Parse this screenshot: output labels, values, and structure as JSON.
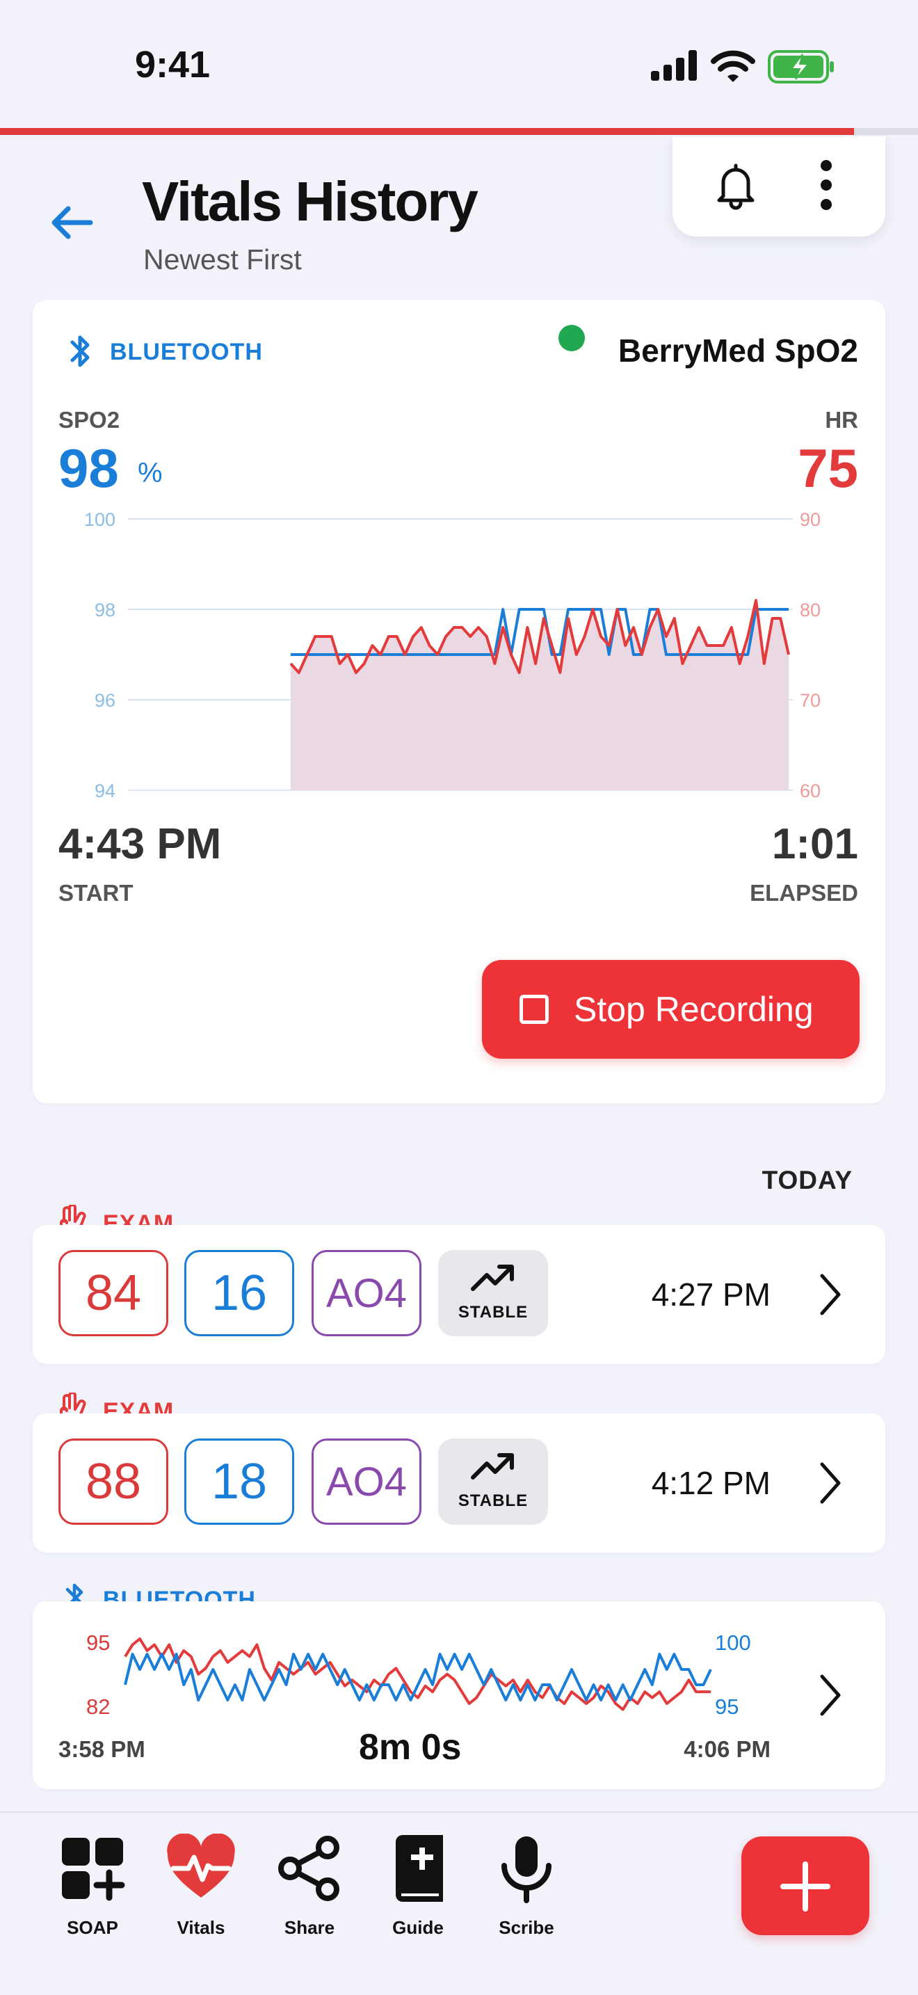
{
  "status_bar": {
    "time": "9:41"
  },
  "progress": {
    "fraction": 0.93
  },
  "header": {
    "title": "Vitals History",
    "subtitle": "Newest First"
  },
  "live": {
    "source": "BLUETOOTH",
    "device": "BerryMed SpO2",
    "spo2_label": "SPO2",
    "spo2_value": "98",
    "spo2_unit": "%",
    "hr_label": "HR",
    "hr_value": "75",
    "start_time": "4:43 PM",
    "start_label": "START",
    "elapsed_time": "1:01",
    "elapsed_label": "ELAPSED",
    "stop_label": "Stop Recording"
  },
  "section": {
    "today": "TODAY"
  },
  "entries": [
    {
      "tag": "EXAM",
      "hr": "84",
      "rr": "16",
      "ao": "AO4",
      "trend": "STABLE",
      "time": "4:27 PM"
    },
    {
      "tag": "EXAM",
      "hr": "88",
      "rr": "18",
      "ao": "AO4",
      "trend": "STABLE",
      "time": "4:12 PM"
    }
  ],
  "bt_entry": {
    "tag": "BLUETOOTH",
    "left_top": "95",
    "left_bottom": "82",
    "right_top": "100",
    "right_bottom": "95",
    "start": "3:58 PM",
    "duration": "8m 0s",
    "end": "4:06 PM"
  },
  "nav": {
    "items": [
      {
        "label": "SOAP",
        "icon": "soap-icon"
      },
      {
        "label": "Vitals",
        "icon": "heart-pulse-icon"
      },
      {
        "label": "Share",
        "icon": "share-icon"
      },
      {
        "label": "Guide",
        "icon": "guide-book-icon"
      },
      {
        "label": "Scribe",
        "icon": "microphone-icon"
      }
    ]
  },
  "colors": {
    "accent_red": "#ee3338",
    "accent_blue": "#1a7ed8",
    "accent_purple": "#8a4aad",
    "online_green": "#1fa84f"
  },
  "chart_data": [
    {
      "type": "line",
      "title": "",
      "x": [
        0,
        1,
        2,
        3,
        4,
        5,
        6,
        7,
        8,
        9,
        10,
        11,
        12,
        13,
        14,
        15,
        16,
        17,
        18,
        19,
        20,
        21,
        22,
        23,
        24,
        25,
        26,
        27,
        28,
        29,
        30,
        31,
        32,
        33,
        34,
        35,
        36,
        37,
        38,
        39,
        40,
        41,
        42,
        43,
        44,
        45,
        46,
        47,
        48,
        49,
        50,
        51,
        52,
        53,
        54,
        55,
        56,
        57,
        58,
        59,
        60,
        61
      ],
      "series": [
        {
          "name": "SPO2",
          "axis": "left",
          "values": [
            97,
            97,
            97,
            97,
            97,
            97,
            97,
            97,
            97,
            97,
            97,
            97,
            97,
            97,
            97,
            97,
            97,
            97,
            97,
            97,
            97,
            97,
            97,
            97,
            97,
            97,
            98,
            97,
            98,
            98,
            98,
            98,
            97,
            97,
            98,
            98,
            98,
            98,
            98,
            97,
            98,
            98,
            97,
            97,
            98,
            98,
            97,
            97,
            97,
            97,
            97,
            97,
            97,
            97,
            97,
            97,
            97,
            98,
            98,
            98,
            98,
            98
          ]
        },
        {
          "name": "HR",
          "axis": "right",
          "values": [
            74,
            73,
            75,
            77,
            77,
            77,
            74,
            75,
            73,
            74,
            76,
            75,
            77,
            77,
            75,
            77,
            78,
            76,
            75,
            77,
            78,
            78,
            77,
            78,
            77,
            74,
            78,
            75,
            73,
            78,
            74,
            79,
            76,
            73,
            79,
            75,
            77,
            80,
            77,
            76,
            80,
            76,
            78,
            75,
            78,
            80,
            77,
            79,
            74,
            76,
            78,
            76,
            76,
            76,
            78,
            74,
            77,
            81,
            74,
            79,
            79,
            75
          ]
        }
      ],
      "y_left_ticks": [
        94,
        96,
        98,
        100
      ],
      "ylim_left": [
        94,
        100
      ],
      "y_right_ticks": [
        60,
        70,
        80,
        90
      ],
      "ylim_right": [
        60,
        90
      ],
      "grid": true
    },
    {
      "type": "line",
      "title": "",
      "x": [
        0,
        1,
        2,
        3,
        4,
        5,
        6,
        7,
        8,
        9,
        10,
        11,
        12,
        13,
        14,
        15,
        16,
        17,
        18,
        19,
        20,
        21,
        22,
        23,
        24,
        25,
        26,
        27,
        28,
        29,
        30,
        31,
        32,
        33,
        34,
        35,
        36,
        37,
        38,
        39,
        40,
        41,
        42,
        43,
        44,
        45,
        46,
        47,
        48,
        49,
        50,
        51,
        52,
        53,
        54,
        55,
        56,
        57,
        58,
        59,
        60,
        61,
        62,
        63,
        64,
        65,
        66,
        67,
        68,
        69,
        70,
        71,
        72,
        73,
        74,
        75,
        76,
        77,
        78,
        79,
        80
      ],
      "series": [
        {
          "name": "HR",
          "axis": "left",
          "values": [
            92,
            94,
            95,
            93,
            94,
            92,
            94,
            91,
            93,
            92,
            89,
            90,
            92,
            93,
            91,
            92,
            93,
            92,
            94,
            90,
            88,
            91,
            90,
            89,
            90,
            91,
            89,
            90,
            91,
            89,
            87,
            88,
            87,
            86,
            88,
            87,
            89,
            90,
            88,
            86,
            85,
            87,
            86,
            88,
            89,
            88,
            86,
            84,
            85,
            87,
            89,
            88,
            87,
            88,
            86,
            88,
            86,
            85,
            87,
            85,
            84,
            86,
            85,
            84,
            85,
            87,
            86,
            84,
            83,
            85,
            84,
            86,
            85,
            86,
            84,
            85,
            86,
            88,
            86,
            86,
            86
          ]
        },
        {
          "name": "SPO2",
          "axis": "right",
          "values": [
            97,
            99,
            98,
            99,
            98,
            99,
            98,
            99,
            97,
            98,
            96,
            97,
            98,
            97,
            96,
            97,
            96,
            98,
            97,
            96,
            97,
            98,
            97,
            99,
            98,
            99,
            98,
            99,
            98,
            97,
            98,
            97,
            96,
            97,
            96,
            97,
            97,
            96,
            97,
            96,
            97,
            98,
            97,
            99,
            98,
            99,
            98,
            99,
            98,
            97,
            98,
            97,
            96,
            97,
            96,
            97,
            96,
            97,
            97,
            96,
            97,
            98,
            97,
            96,
            97,
            96,
            97,
            96,
            97,
            96,
            97,
            98,
            97,
            99,
            98,
            99,
            98,
            98,
            97,
            97,
            98
          ]
        }
      ],
      "ylim_left": [
        82,
        95
      ],
      "ylim_right": [
        95,
        100
      ]
    }
  ]
}
